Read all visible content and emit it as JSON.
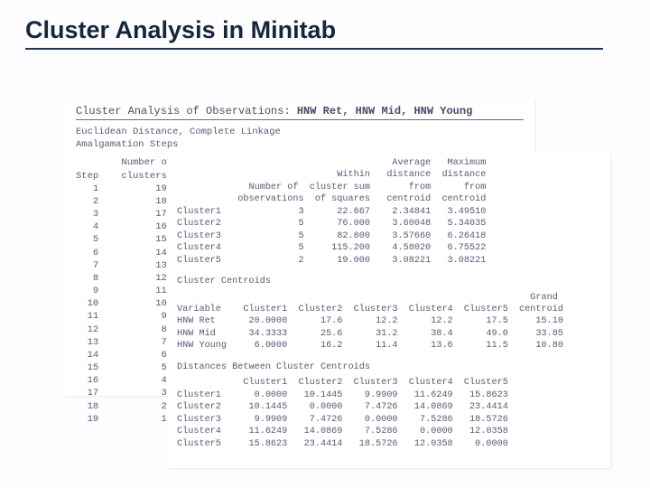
{
  "title": "Cluster Analysis in Minitab",
  "session": {
    "heading_plain": "Cluster Analysis of Observations: ",
    "heading_bold": "HNW Ret, HNW Mid, HNW Young",
    "method_lines": [
      "Euclidean Distance, Complete Linkage",
      "Amalgamation Steps"
    ],
    "step_header1": "        Number of   N",
    "step_header2": "Step    clusters",
    "steps": [
      "   1          19",
      "   2          18",
      "   3          17",
      "   4          16",
      "   5          15",
      "   6          14",
      "   7          13",
      "   8          12",
      "   9          11",
      "  10          10",
      "  11           9",
      "  12           8",
      "  13           7",
      "  14           6",
      "  15           5",
      "  16           4",
      "  17           3",
      "  18           2",
      "  19           1"
    ]
  },
  "front": {
    "stats_header": [
      "                                       Average   Maximum",
      "                             Within   distance  distance",
      "             Number of  cluster sum       from      from",
      "           observations  of squares   centroid  centroid"
    ],
    "stats_rows": [
      "Cluster1              3      22.667    2.34841   3.49510",
      "Cluster2              5      76.000    3.60048   5.34035",
      "Cluster3              5      82.800    3.57660   6.26418",
      "Cluster4              5     115.200    4.58020   6.75522",
      "Cluster5              2      19.000    3.08221   3.08221"
    ],
    "centroids_title": "Cluster Centroids",
    "centroids_header": [
      "                                                                Grand",
      "Variable    Cluster1  Cluster2  Cluster3  Cluster4  Cluster5  centroid"
    ],
    "centroids_rows": [
      "HNW Ret      20.0000      17.6      12.2      12.2      17.5     15.10",
      "HNW Mid      34.3333      25.6      31.2      38.4      49.0     33.85",
      "HNW Young     6.0000      16.2      11.4      13.6      11.5     10.80"
    ],
    "distances_title": "Distances Between Cluster Centroids",
    "distances_header": "            Cluster1  Cluster2  Cluster3  Cluster4  Cluster5",
    "distances_rows": [
      "Cluster1      0.0000   10.1445    9.9909   11.6249   15.8623",
      "Cluster2     10.1445    0.0000    7.4726   14.0869   23.4414",
      "Cluster3      9.9909    7.4726    0.0000    7.5286   18.5726",
      "Cluster4     11.6249   14.0869    7.5286    0.0000   12.0358",
      "Cluster5     15.8623   23.4414   18.5726   12.0358    0.0000"
    ]
  }
}
